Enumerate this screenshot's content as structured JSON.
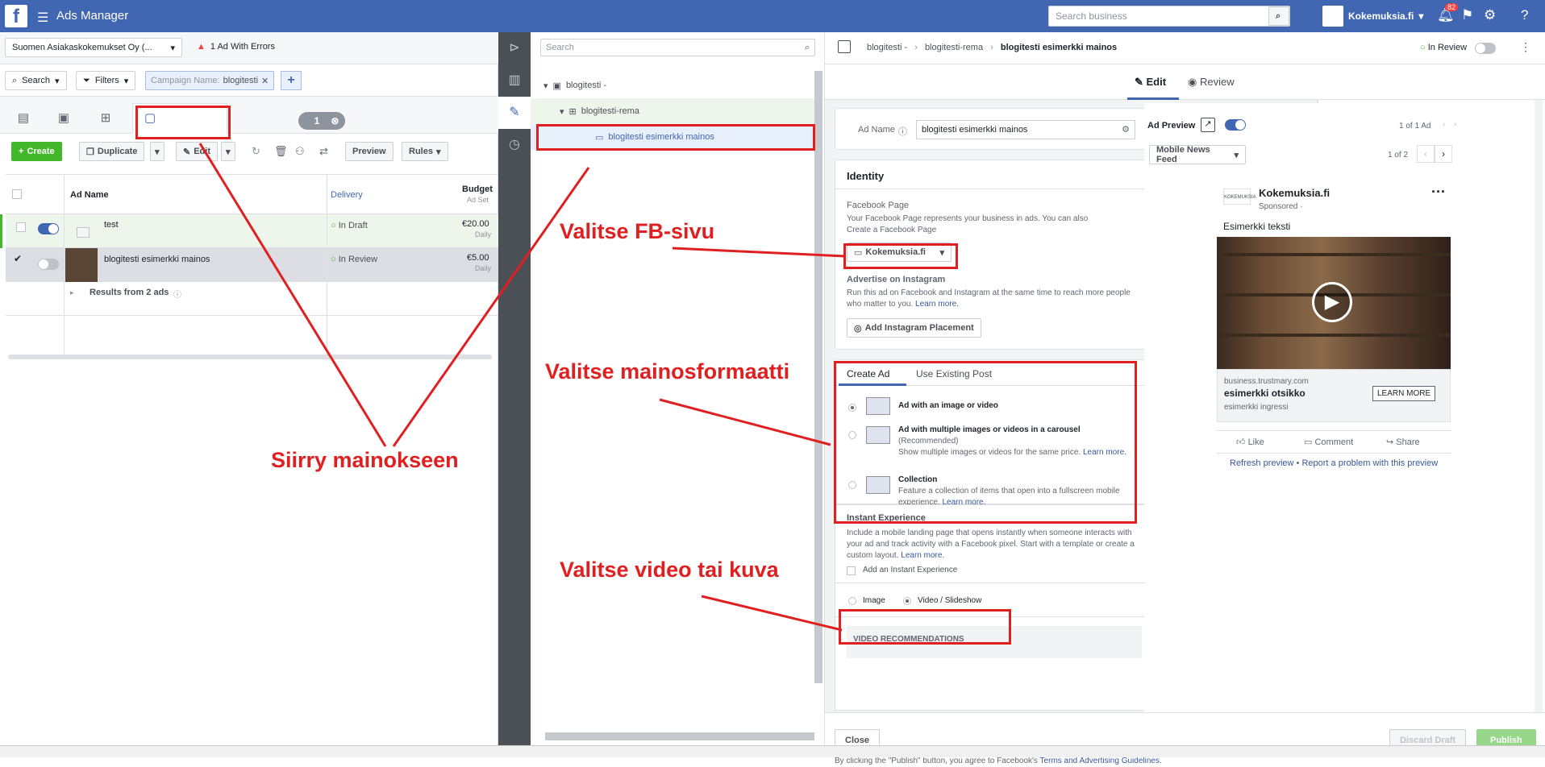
{
  "topbar": {
    "title": "Ads Manager",
    "search_placeholder": "Search business",
    "account": "Kokemuksia.fi",
    "notifications": "82"
  },
  "left": {
    "account_selector": "Suomen Asiakaskokemukset Oy (...",
    "errors": "1 Ad With Errors",
    "search": "Search",
    "filters": "Filters",
    "chip_label": "Campaign Name:",
    "chip_value": "blogitesti",
    "selected_count": "1",
    "actions": {
      "create": "Create",
      "duplicate": "Duplicate",
      "edit": "Edit",
      "preview": "Preview",
      "rules": "Rules"
    },
    "columns": {
      "name": "Ad Name",
      "delivery": "Delivery",
      "budget": "Budget",
      "budget_sub": "Ad Set"
    },
    "rows": [
      {
        "name": "test",
        "delivery": "In Draft",
        "budget": "€20.00",
        "period": "Daily"
      },
      {
        "name": "blogitesti esimerkki mainos",
        "delivery": "In Review",
        "budget": "€5.00",
        "period": "Daily"
      }
    ],
    "results": "Results from 2 ads"
  },
  "tree": {
    "search_placeholder": "Search",
    "campaign": "blogitesti -",
    "adset": "blogitesti-rema",
    "ad": "blogitesti esimerkki mainos"
  },
  "editor": {
    "crumb1": "blogitesti -",
    "crumb2": "blogitesti-rema",
    "crumb3": "blogitesti esimerkki mainos",
    "status": "In Review",
    "tab_edit": "Edit",
    "tab_review": "Review",
    "ad_name_label": "Ad Name",
    "ad_name_value": "blogitesti esimerkki mainos",
    "identity": "Identity",
    "fb_page_label": "Facebook Page",
    "fb_page_desc": "Your Facebook Page represents your business in ads. You can also",
    "fb_page_link": "Create a Facebook Page",
    "page_value": "Kokemuksia.fi",
    "ig_label": "Advertise on Instagram",
    "ig_desc": "Run this ad on Facebook and Instagram at the same time to reach more people who matter to you.",
    "learn_more": "Learn more.",
    "ig_button": "Add Instagram Placement",
    "create_tab": "Create Ad",
    "existing_tab": "Use Existing Post",
    "fmt1": "Ad with an image or video",
    "fmt2": "Ad with multiple images or videos in a carousel",
    "fmt2_rec": "(Recommended)",
    "fmt2_desc": "Show multiple images or videos for the same price.",
    "fmt3": "Collection",
    "fmt3_desc": "Feature a collection of items that open into a fullscreen mobile experience.",
    "ie_label": "Instant Experience",
    "ie_desc": "Include a mobile landing page that opens instantly when someone interacts with your ad and track activity with a Facebook pixel. Start with a template or create a custom layout.",
    "ie_check": "Add an Instant Experience",
    "media_image": "Image",
    "media_video": "Video / Slideshow",
    "video_rec": "VIDEO RECOMMENDATIONS",
    "close": "Close",
    "discard": "Discard Draft",
    "publish": "Publish",
    "terms": "By clicking the \"Publish\" button, you agree to Facebook's",
    "terms_link": "Terms and Advertising Guidelines."
  },
  "preview": {
    "label": "Ad Preview",
    "count": "1 of 1 Ad",
    "placement": "Mobile News Feed",
    "page_count": "1 of 2",
    "page_name": "Kokemuksia.fi",
    "sponsored": "Sponsored · ",
    "text": "Esimerkki teksti",
    "domain": "business.trustmary.com",
    "headline": "esimerkki otsikko",
    "desc": "esimerkki ingressi",
    "cta": "LEARN MORE",
    "like": "Like",
    "comment": "Comment",
    "share": "Share",
    "refresh": "Refresh preview",
    "report": "Report a problem with this preview"
  },
  "annotations": {
    "a1": "Valitse FB-sivu",
    "a2": "Valitse mainosformaatti",
    "a3": "Valitse video tai kuva",
    "a4": "Siirry mainokseen"
  }
}
